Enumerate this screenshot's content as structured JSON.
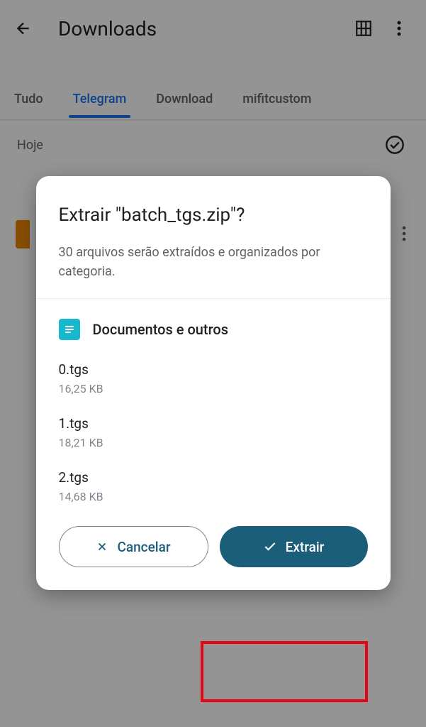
{
  "header": {
    "title": "Downloads"
  },
  "tabs": {
    "items": [
      {
        "label": "Tudo",
        "active": false
      },
      {
        "label": "Telegram",
        "active": true
      },
      {
        "label": "Download",
        "active": false
      },
      {
        "label": "mifitcustom",
        "active": false
      }
    ]
  },
  "section": {
    "label": "Hoje"
  },
  "dialog": {
    "title": "Extrair \"batch_tgs.zip\"?",
    "subtitle": "30 arquivos serão extraídos e organizados por categoria.",
    "category_label": "Documentos e outros",
    "files": [
      {
        "name": "0.tgs",
        "size": "16,25 KB"
      },
      {
        "name": "1.tgs",
        "size": "18,21 KB"
      },
      {
        "name": "2.tgs",
        "size": "14,68 KB"
      }
    ],
    "cancel_label": "Cancelar",
    "extract_label": "Extrair"
  }
}
